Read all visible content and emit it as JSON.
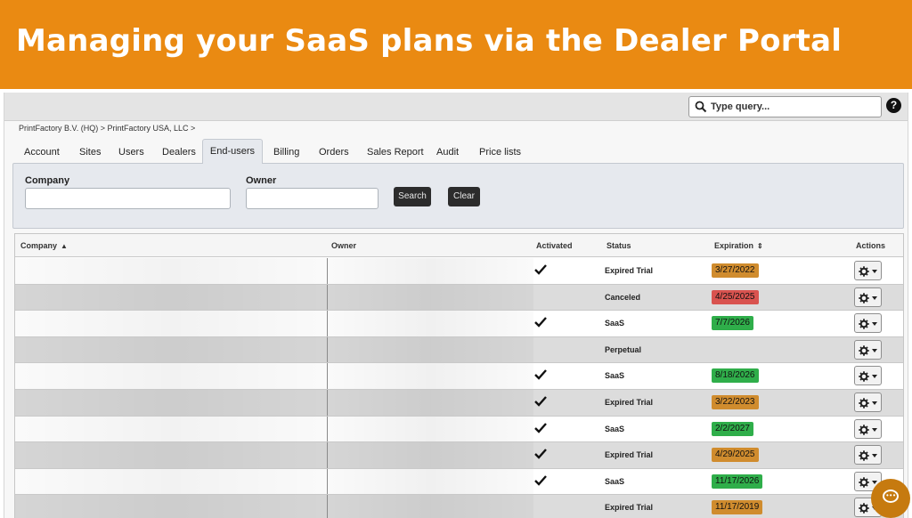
{
  "banner": {
    "title": "Managing your SaaS plans via the Dealer Portal"
  },
  "search": {
    "placeholder": "Type query..."
  },
  "help": {
    "label": "?"
  },
  "breadcrumb": "PrintFactory B.V. (HQ) > PrintFactory USA, LLC >",
  "tabs": [
    {
      "label": "Account"
    },
    {
      "label": "Sites"
    },
    {
      "label": "Users"
    },
    {
      "label": "Dealers"
    },
    {
      "label": "End-users",
      "active": true
    },
    {
      "label": "Billing"
    },
    {
      "label": "Orders"
    },
    {
      "label": "Sales Report"
    },
    {
      "label": "Audit"
    },
    {
      "label": "Price lists"
    }
  ],
  "filter": {
    "company_label": "Company",
    "owner_label": "Owner",
    "company_value": "",
    "owner_value": "",
    "search_label": "Search",
    "clear_label": "Clear"
  },
  "table": {
    "headers": {
      "company": "Company",
      "owner": "Owner",
      "activated": "Activated",
      "status": "Status",
      "expiration": "Expiration",
      "actions": "Actions"
    },
    "sort_icons": {
      "company": "▲",
      "expiration": "⇕"
    },
    "rows": [
      {
        "activated": true,
        "status": "Expired Trial",
        "expiration": "3/27/2022",
        "badge": "orange"
      },
      {
        "activated": false,
        "status": "Canceled",
        "expiration": "4/25/2025",
        "badge": "red"
      },
      {
        "activated": true,
        "status": "SaaS",
        "expiration": "7/7/2026",
        "badge": "green"
      },
      {
        "activated": false,
        "status": "Perpetual",
        "expiration": "",
        "badge": "none"
      },
      {
        "activated": true,
        "status": "SaaS",
        "expiration": "8/18/2026",
        "badge": "green"
      },
      {
        "activated": true,
        "status": "Expired Trial",
        "expiration": "3/22/2023",
        "badge": "orange"
      },
      {
        "activated": true,
        "status": "SaaS",
        "expiration": "2/2/2027",
        "badge": "green"
      },
      {
        "activated": true,
        "status": "Expired Trial",
        "expiration": "4/29/2025",
        "badge": "orange"
      },
      {
        "activated": true,
        "status": "SaaS",
        "expiration": "11/17/2026",
        "badge": "green"
      },
      {
        "activated": false,
        "status": "Expired Trial",
        "expiration": "11/17/2019",
        "badge": "orange"
      }
    ]
  },
  "colors": {
    "banner": "#ea8a12",
    "badge_orange": "#d08c2e",
    "badge_red": "#d9534f",
    "badge_green": "#2fae4a",
    "chat": "#c67a0f"
  },
  "icons": {
    "search": "magnifier-icon",
    "help": "question-circle-icon",
    "check": "checkmark-icon",
    "actions": "gear-icon",
    "dropdown": "caret-down-icon",
    "chat": "chat-bubble-icon"
  }
}
